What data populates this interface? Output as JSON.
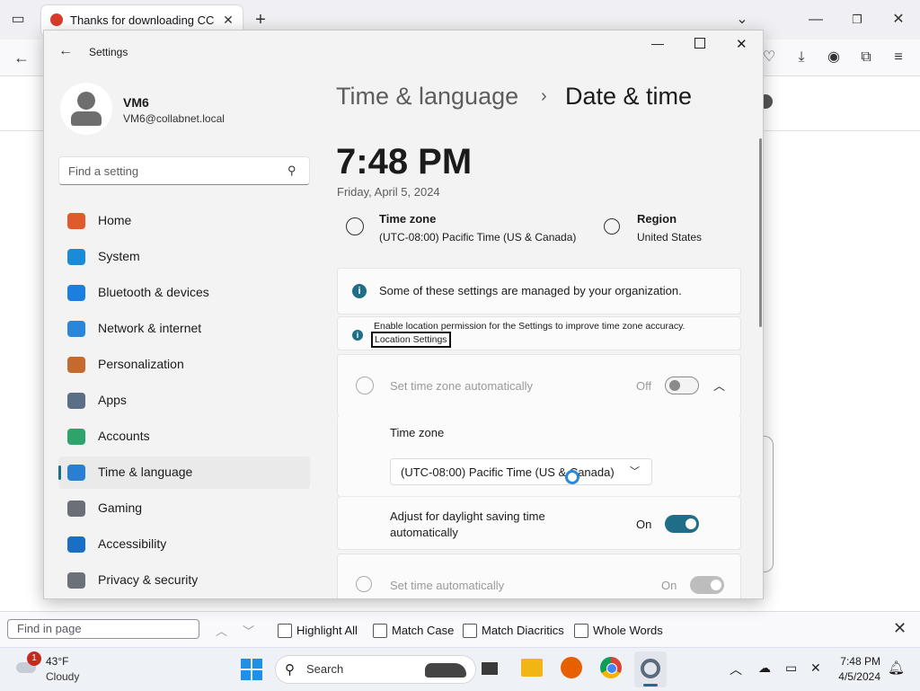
{
  "browser": {
    "tab_title": "Thanks for downloading CCleaner",
    "new_tab_symbol": "+",
    "find": {
      "placeholder": "Find in page",
      "options": [
        "Highlight All",
        "Match Case",
        "Match Diacritics",
        "Whole Words"
      ]
    }
  },
  "settings": {
    "app_title": "Settings",
    "user": {
      "name": "VM6",
      "email": "VM6@collabnet.local"
    },
    "search": {
      "placeholder": "Find a setting"
    },
    "sidebar": [
      {
        "label": "Home",
        "icon": "home-icon",
        "color": "#e05a2b"
      },
      {
        "label": "System",
        "icon": "system-icon",
        "color": "#1a8bd6"
      },
      {
        "label": "Bluetooth & devices",
        "icon": "bluetooth-icon",
        "color": "#1c7ee0"
      },
      {
        "label": "Network & internet",
        "icon": "wifi-icon",
        "color": "#2a86d8"
      },
      {
        "label": "Personalization",
        "icon": "brush-icon",
        "color": "#c46a2e"
      },
      {
        "label": "Apps",
        "icon": "apps-icon",
        "color": "#5a6f86"
      },
      {
        "label": "Accounts",
        "icon": "accounts-icon",
        "color": "#2ea36c"
      },
      {
        "label": "Time & language",
        "icon": "globe-clock-icon",
        "color": "#2a7fd3",
        "active": true
      },
      {
        "label": "Gaming",
        "icon": "gamepad-icon",
        "color": "#6b7078"
      },
      {
        "label": "Accessibility",
        "icon": "accessibility-icon",
        "color": "#1a6fc4"
      },
      {
        "label": "Privacy & security",
        "icon": "shield-icon",
        "color": "#6b7178"
      }
    ],
    "breadcrumb": {
      "parent": "Time & language",
      "separator": "›",
      "current": "Date & time"
    },
    "clock": {
      "time": "7:48 PM",
      "date": "Friday, April 5, 2024"
    },
    "summary": {
      "timezone_label": "Time zone",
      "timezone_value": "(UTC-08:00) Pacific Time (US & Canada)",
      "region_label": "Region",
      "region_value": "United States"
    },
    "org_notice": "Some of these settings are managed by your organization.",
    "location_notice": "Enable location permission for the Settings to improve time zone accuracy.",
    "location_link": "Location Settings",
    "set_tz_auto": {
      "label": "Set time zone automatically",
      "state": "Off"
    },
    "timezone_section": {
      "label": "Time zone",
      "value": "(UTC-08:00) Pacific Time (US & Canada)"
    },
    "daylight": {
      "label_line1": "Adjust for daylight saving time",
      "label_line2": "automatically",
      "state": "On"
    },
    "set_time_auto": {
      "label": "Set time automatically",
      "state": "On"
    }
  },
  "taskbar": {
    "weather": {
      "temp": "43°F",
      "condition": "Cloudy",
      "badge": "1"
    },
    "search_placeholder": "Search",
    "clock_time": "7:48 PM",
    "clock_date": "4/5/2024"
  },
  "colors": {
    "accent": "#1f6d87",
    "info": "#1f6d87"
  }
}
